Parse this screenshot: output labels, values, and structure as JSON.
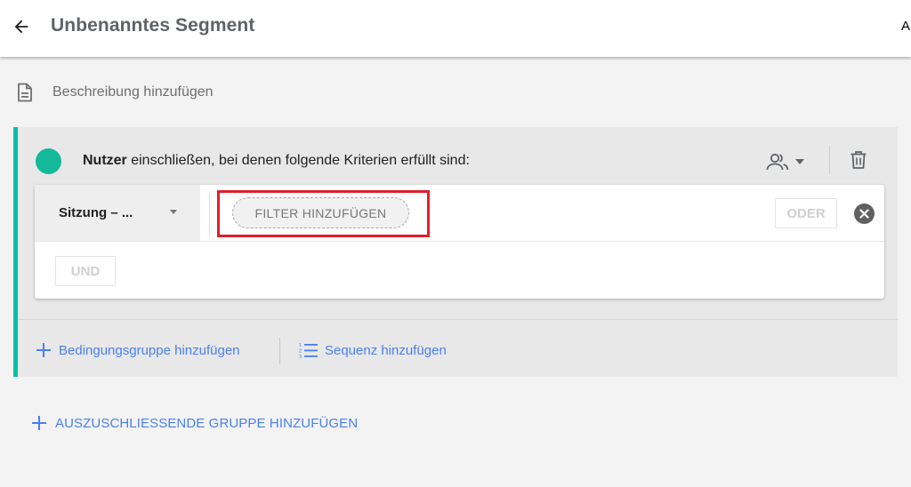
{
  "header": {
    "title": "Unbenanntes Segment",
    "right_text": "A"
  },
  "description": {
    "label": "Beschreibung hinzufügen"
  },
  "group": {
    "heading_bold": "Nutzer",
    "heading_rest": " einschließen, bei denen folgende Kriterien erfüllt sind:",
    "accent_color": "#00bfa5",
    "dimension_select": "Sitzung – ...",
    "filter_button": "FILTER HINZUFÜGEN",
    "or_button": "ODER",
    "and_button": "UND",
    "add_condition_group": "Bedingungsgruppe hinzufügen",
    "add_sequence": "Sequenz hinzufügen"
  },
  "add_exclude_group": "AUSZUSCHLIESSENDE GRUPPE HINZUFÜGEN",
  "colors": {
    "link_blue": "#4a7ff0",
    "highlight_red": "#e01e2b"
  }
}
